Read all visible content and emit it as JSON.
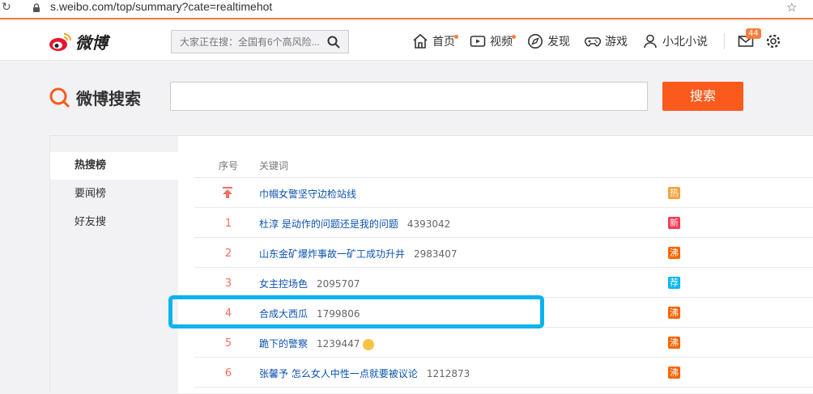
{
  "browser": {
    "url": "s.weibo.com/top/summary?cate=realtimehot"
  },
  "topnav": {
    "logo_text": "微博",
    "search_placeholder": "大家正在搜：全国有6个高风险...",
    "items": [
      {
        "label": "首页",
        "icon": "home-icon",
        "dot": true
      },
      {
        "label": "视频",
        "icon": "video-icon",
        "dot": true
      },
      {
        "label": "发现",
        "icon": "compass-icon",
        "dot": false
      },
      {
        "label": "游戏",
        "icon": "gamepad-icon",
        "dot": false
      },
      {
        "label": "小北小说",
        "icon": "user-icon",
        "dot": false
      }
    ],
    "mail_badge": "44"
  },
  "search": {
    "logo_text": "微博搜索",
    "value": "",
    "button_label": "搜索"
  },
  "sidebar": {
    "items": [
      {
        "label": "热搜榜",
        "active": true
      },
      {
        "label": "要闻榜",
        "active": false
      },
      {
        "label": "好友搜",
        "active": false
      }
    ]
  },
  "table": {
    "headers": {
      "rank": "序号",
      "keyword": "关键词"
    },
    "rows": [
      {
        "rank": "",
        "pinned": true,
        "keyword": "巾帼女警坚守边检站线",
        "count": "",
        "tag": "热",
        "tag_color": "#f8a23a"
      },
      {
        "rank": "1",
        "keyword": "杜淳 是动作的问题还是我的问题",
        "count": "4393042",
        "tag": "新",
        "tag_color": "#ff3852"
      },
      {
        "rank": "2",
        "keyword": "山东金矿爆炸事故一矿工成功升井",
        "count": "2983407",
        "tag": "沸",
        "tag_color": "#f86400"
      },
      {
        "rank": "3",
        "keyword": "女主控场色",
        "count": "2095707",
        "tag": "荐",
        "tag_color": "#00b7ee"
      },
      {
        "rank": "4",
        "keyword": "合成大西瓜",
        "count": "1799806",
        "tag": "沸",
        "tag_color": "#f86400"
      },
      {
        "rank": "5",
        "keyword": "跪下的警察",
        "count": "1239447",
        "emoji": true,
        "tag": "沸",
        "tag_color": "#f86400"
      },
      {
        "rank": "6",
        "keyword": "张馨予 怎么女人中性一点就要被议论",
        "count": "1212873",
        "tag": "沸",
        "tag_color": "#f86400"
      }
    ]
  },
  "colors": {
    "accent": "#fa5a1c",
    "highlight": "#0ab2f0"
  }
}
